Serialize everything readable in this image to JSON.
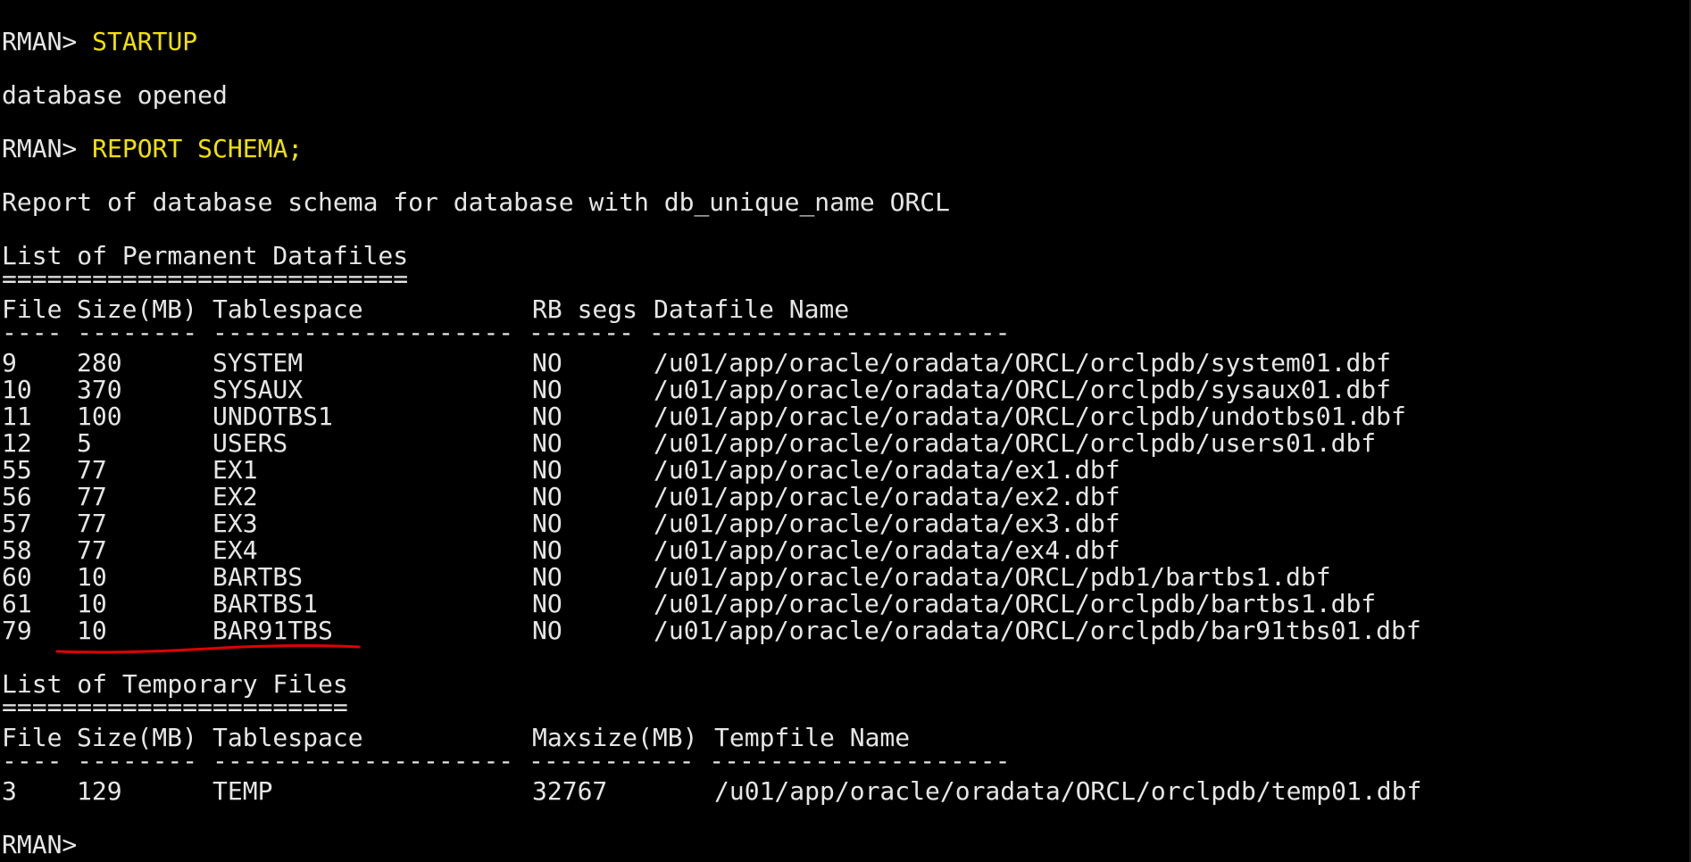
{
  "session": {
    "prompt": "RMAN> ",
    "prompt_bare": "RMAN>",
    "cmd1": "STARTUP",
    "msg1": "database opened",
    "cmd2": "REPORT SCHEMA;",
    "report_title": "Report of database schema for database with db_unique_name ORCL"
  },
  "permanent": {
    "title": "List of Permanent Datafiles",
    "title_rule": "===========================",
    "headers": [
      "File",
      "Size(MB)",
      "Tablespace",
      "RB segs",
      "Datafile Name"
    ],
    "header_rule": "---- -------- -------------------- ------- ------------------------",
    "rows": [
      [
        "9",
        "280",
        "SYSTEM",
        "NO",
        "/u01/app/oracle/oradata/ORCL/orclpdb/system01.dbf"
      ],
      [
        "10",
        "370",
        "SYSAUX",
        "NO",
        "/u01/app/oracle/oradata/ORCL/orclpdb/sysaux01.dbf"
      ],
      [
        "11",
        "100",
        "UNDOTBS1",
        "NO",
        "/u01/app/oracle/oradata/ORCL/orclpdb/undotbs01.dbf"
      ],
      [
        "12",
        "5",
        "USERS",
        "NO",
        "/u01/app/oracle/oradata/ORCL/orclpdb/users01.dbf"
      ],
      [
        "55",
        "77",
        "EX1",
        "NO",
        "/u01/app/oracle/oradata/ex1.dbf"
      ],
      [
        "56",
        "77",
        "EX2",
        "NO",
        "/u01/app/oracle/oradata/ex2.dbf"
      ],
      [
        "57",
        "77",
        "EX3",
        "NO",
        "/u01/app/oracle/oradata/ex3.dbf"
      ],
      [
        "58",
        "77",
        "EX4",
        "NO",
        "/u01/app/oracle/oradata/ex4.dbf"
      ],
      [
        "60",
        "10",
        "BARTBS",
        "NO",
        "/u01/app/oracle/oradata/ORCL/pdb1/bartbs1.dbf"
      ],
      [
        "61",
        "10",
        "BARTBS1",
        "NO",
        "/u01/app/oracle/oradata/ORCL/orclpdb/bartbs1.dbf"
      ],
      [
        "79",
        "10",
        "BAR91TBS",
        "NO",
        "/u01/app/oracle/oradata/ORCL/orclpdb/bar91tbs01.dbf"
      ]
    ]
  },
  "temporary": {
    "title": "List of Temporary Files",
    "title_rule": "=======================",
    "headers": [
      "File",
      "Size(MB)",
      "Tablespace",
      "Maxsize(MB)",
      "Tempfile Name"
    ],
    "header_rule": "---- -------- -------------------- ----------- --------------------",
    "rows": [
      [
        "3",
        "129",
        "TEMP",
        "32767",
        "/u01/app/oracle/oradata/ORCL/orclpdb/temp01.dbf"
      ]
    ]
  },
  "annotation": {
    "underline_color": "#e00000"
  }
}
